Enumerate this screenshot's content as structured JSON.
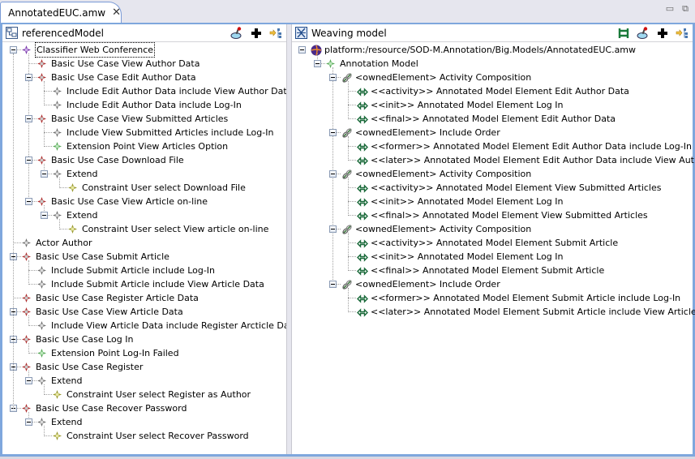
{
  "editor_tab": {
    "title": "AnnotatedEUC.amw",
    "close_glyph": "✕"
  },
  "window_controls": {
    "minimize": "▭",
    "restore": "⧉"
  },
  "left_pane": {
    "title": "referencedModel",
    "tree": [
      {
        "depth": 0,
        "label": "Classifier Web Conference",
        "icon": "classifier",
        "expanded": true,
        "selected": true
      },
      {
        "depth": 1,
        "label": "Basic Use Case View Author Data",
        "icon": "usecase"
      },
      {
        "depth": 1,
        "label": "Basic Use Case Edit Author Data",
        "icon": "usecase",
        "expanded": true
      },
      {
        "depth": 2,
        "label": "Include Edit Author Data include View Author Data",
        "icon": "include"
      },
      {
        "depth": 2,
        "label": "Include Edit Author Data include Log-In",
        "icon": "include"
      },
      {
        "depth": 1,
        "label": "Basic Use Case View Submitted Articles",
        "icon": "usecase",
        "expanded": true
      },
      {
        "depth": 2,
        "label": "Include View Submitted Articles include Log-In",
        "icon": "include"
      },
      {
        "depth": 2,
        "label": "Extension Point View Articles Option",
        "icon": "extension"
      },
      {
        "depth": 1,
        "label": "Basic Use Case Download File",
        "icon": "usecase",
        "expanded": true
      },
      {
        "depth": 2,
        "label": "Extend",
        "icon": "include",
        "expanded": true
      },
      {
        "depth": 3,
        "label": "Constraint User select Download File",
        "icon": "constraint"
      },
      {
        "depth": 1,
        "label": "Basic Use Case View Article on-line",
        "icon": "usecase",
        "expanded": true
      },
      {
        "depth": 2,
        "label": "Extend",
        "icon": "include",
        "expanded": true
      },
      {
        "depth": 3,
        "label": "Constraint User select View article on-line",
        "icon": "constraint"
      },
      {
        "depth": 0,
        "label": "Actor Author",
        "icon": "include"
      },
      {
        "depth": 0,
        "label": "Basic Use Case Submit Article",
        "icon": "usecase",
        "expanded": true
      },
      {
        "depth": 1,
        "label": "Include Submit Article include Log-In",
        "icon": "include"
      },
      {
        "depth": 1,
        "label": "Include Submit Article include View Article Data",
        "icon": "include"
      },
      {
        "depth": 0,
        "label": "Basic Use Case Register Article Data",
        "icon": "usecase"
      },
      {
        "depth": 0,
        "label": "Basic Use Case View Article Data",
        "icon": "usecase",
        "expanded": true
      },
      {
        "depth": 1,
        "label": "Include View Article Data  include Register Arcticle Data",
        "icon": "include"
      },
      {
        "depth": 0,
        "label": "Basic Use Case Log In",
        "icon": "usecase",
        "expanded": true
      },
      {
        "depth": 1,
        "label": "Extension Point Log-In Failed",
        "icon": "extension"
      },
      {
        "depth": 0,
        "label": "Basic Use Case Register",
        "icon": "usecase",
        "expanded": true
      },
      {
        "depth": 1,
        "label": "Extend",
        "icon": "include",
        "expanded": true
      },
      {
        "depth": 2,
        "label": "Constraint User select Register as Author",
        "icon": "constraint"
      },
      {
        "depth": 0,
        "label": "Basic Use Case Recover Password",
        "icon": "usecase",
        "expanded": true
      },
      {
        "depth": 1,
        "label": "Extend",
        "icon": "include",
        "expanded": true
      },
      {
        "depth": 2,
        "label": "Constraint User select Recover Password",
        "icon": "constraint"
      }
    ]
  },
  "right_pane": {
    "title": "Weaving model",
    "tree": [
      {
        "depth": 0,
        "label": "platform:/resource/SOD-M.Annotation/Big.Models/AnnotatedEUC.amw",
        "icon": "resource",
        "expanded": true
      },
      {
        "depth": 1,
        "label": "Annotation Model",
        "icon": "extension",
        "expanded": true
      },
      {
        "depth": 2,
        "label": "<ownedElement> Activity Composition",
        "icon": "link",
        "expanded": true
      },
      {
        "depth": 3,
        "label": "<<activity>> Annotated Model Element Edit Author Data",
        "icon": "ref"
      },
      {
        "depth": 3,
        "label": "<<init>> Annotated Model Element Log In",
        "icon": "ref"
      },
      {
        "depth": 3,
        "label": "<<final>> Annotated Model Element Edit Author Data",
        "icon": "ref"
      },
      {
        "depth": 2,
        "label": "<ownedElement> Include Order",
        "icon": "link",
        "expanded": true
      },
      {
        "depth": 3,
        "label": "<<former>> Annotated Model Element Edit Author Data include Log-In",
        "icon": "ref"
      },
      {
        "depth": 3,
        "label": "<<later>> Annotated Model Element Edit Author Data include View Author Data",
        "icon": "ref"
      },
      {
        "depth": 2,
        "label": "<ownedElement> Activity Composition",
        "icon": "link",
        "expanded": true
      },
      {
        "depth": 3,
        "label": "<<activity>> Annotated Model Element View Submitted Articles",
        "icon": "ref"
      },
      {
        "depth": 3,
        "label": "<<init>> Annotated Model Element Log In",
        "icon": "ref"
      },
      {
        "depth": 3,
        "label": "<<final>> Annotated Model Element View Submitted Articles",
        "icon": "ref"
      },
      {
        "depth": 2,
        "label": "<ownedElement> Activity Composition",
        "icon": "link",
        "expanded": true
      },
      {
        "depth": 3,
        "label": "<<activity>> Annotated Model Element Submit Article",
        "icon": "ref"
      },
      {
        "depth": 3,
        "label": "<<init>> Annotated Model Element Log In",
        "icon": "ref"
      },
      {
        "depth": 3,
        "label": "<<final>> Annotated Model Element Submit Article",
        "icon": "ref"
      },
      {
        "depth": 2,
        "label": "<ownedElement> Include Order",
        "icon": "link",
        "expanded": true
      },
      {
        "depth": 3,
        "label": "<<former>> Annotated Model Element Submit Article include Log-In",
        "icon": "ref"
      },
      {
        "depth": 3,
        "label": "<<later>> Annotated Model Element Submit Article include View Article Data",
        "icon": "ref"
      }
    ]
  },
  "colors": {
    "frame_border": "#7fa7dd",
    "usecase": "#b03030",
    "include": "#707070",
    "extension": "#5aa85a",
    "constraint": "#9a9a30",
    "classifier": "#7a3aa8"
  }
}
